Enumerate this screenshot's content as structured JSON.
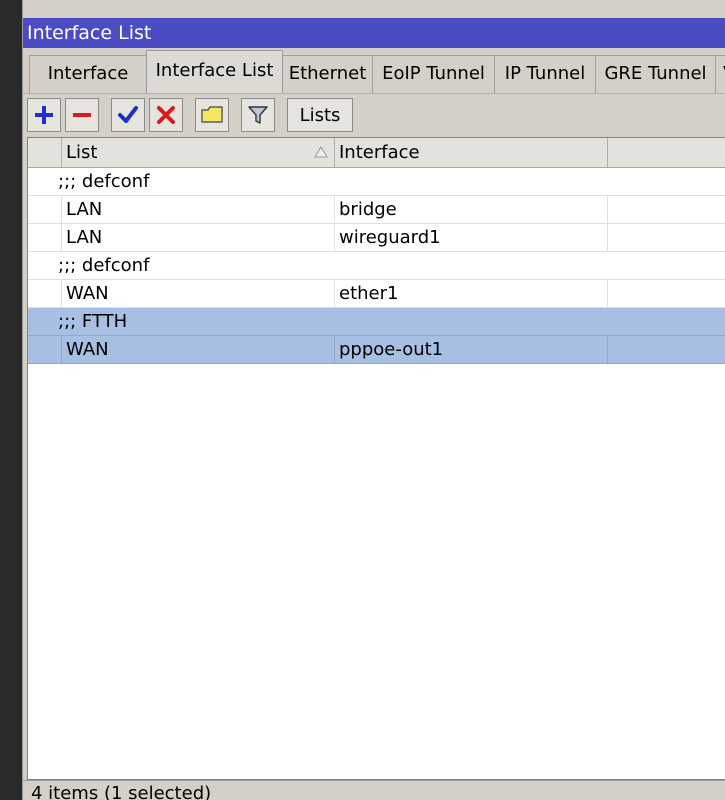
{
  "window": {
    "title": "Interface List"
  },
  "tabs": [
    {
      "label": "Interface",
      "active": false
    },
    {
      "label": "Interface List",
      "active": true
    },
    {
      "label": "Ethernet",
      "active": false
    },
    {
      "label": "EoIP Tunnel",
      "active": false
    },
    {
      "label": "IP Tunnel",
      "active": false
    },
    {
      "label": "GRE Tunnel",
      "active": false
    },
    {
      "label": "VLAN",
      "active": false
    }
  ],
  "toolbar": {
    "buttons": [
      {
        "icon": "add-icon"
      },
      {
        "icon": "remove-icon"
      },
      {
        "icon": "enable-check-icon"
      },
      {
        "icon": "disable-x-icon"
      },
      {
        "icon": "comment-note-icon"
      },
      {
        "icon": "filter-funnel-icon"
      }
    ],
    "lists_label": "Lists"
  },
  "table": {
    "columns": [
      "List",
      "Interface"
    ],
    "sort_column": "List",
    "rows": [
      {
        "type": "comment",
        "text": ";;; defconf",
        "selected": false
      },
      {
        "type": "data",
        "list": "LAN",
        "interface": "bridge",
        "selected": false
      },
      {
        "type": "data",
        "list": "LAN",
        "interface": "wireguard1",
        "selected": false
      },
      {
        "type": "comment",
        "text": ";;; defconf",
        "selected": false
      },
      {
        "type": "data",
        "list": "WAN",
        "interface": "ether1",
        "selected": false
      },
      {
        "type": "comment",
        "text": ";;; FTTH",
        "selected": true
      },
      {
        "type": "data",
        "list": "WAN",
        "interface": "pppoe-out1",
        "selected": true
      }
    ]
  },
  "status": {
    "text": "4 items (1 selected)"
  },
  "colors": {
    "titlebar": "#4b4cc4",
    "selection": "#a6bfe3",
    "chrome": "#d4d0c8"
  }
}
